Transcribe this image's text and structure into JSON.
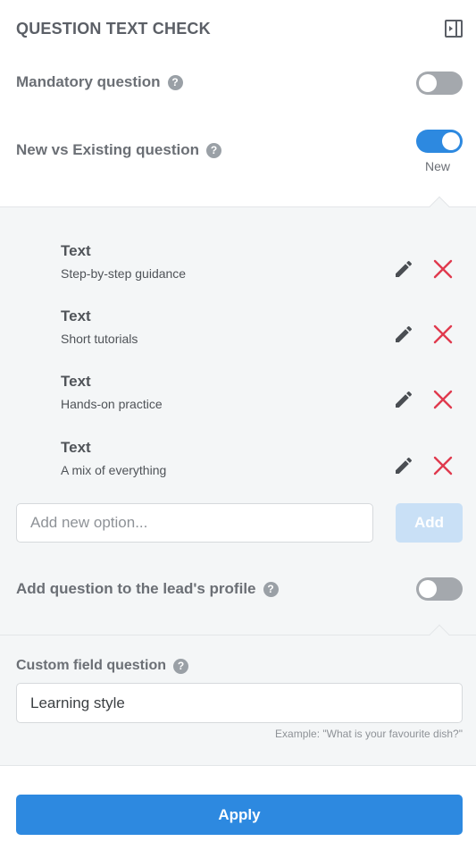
{
  "header": {
    "title": "QUESTION TEXT CHECK",
    "panel_icon": "panel-collapse-icon"
  },
  "mandatory": {
    "label": "Mandatory question",
    "help": "?",
    "enabled": false
  },
  "new_vs_existing": {
    "label": "New vs Existing question",
    "help": "?",
    "enabled": true,
    "caption": "New"
  },
  "options": [
    {
      "title": "Text",
      "value": "Step-by-step guidance"
    },
    {
      "title": "Text",
      "value": "Short tutorials"
    },
    {
      "title": "Text",
      "value": "Hands-on practice"
    },
    {
      "title": "Text",
      "value": "A mix of everything"
    }
  ],
  "new_option": {
    "placeholder": "Add new option...",
    "add_label": "Add"
  },
  "lead_profile": {
    "label": "Add question to the lead's profile",
    "help": "?",
    "enabled": false
  },
  "custom_field": {
    "label": "Custom field question",
    "help": "?",
    "value": "Learning style",
    "example": "Example: \"What is your favourite dish?\""
  },
  "apply_label": "Apply",
  "colors": {
    "accent": "#2d89e0",
    "delete": "#e03a4e",
    "toggle_off": "#a4a8ad",
    "add_disabled": "#c9e0f6"
  }
}
